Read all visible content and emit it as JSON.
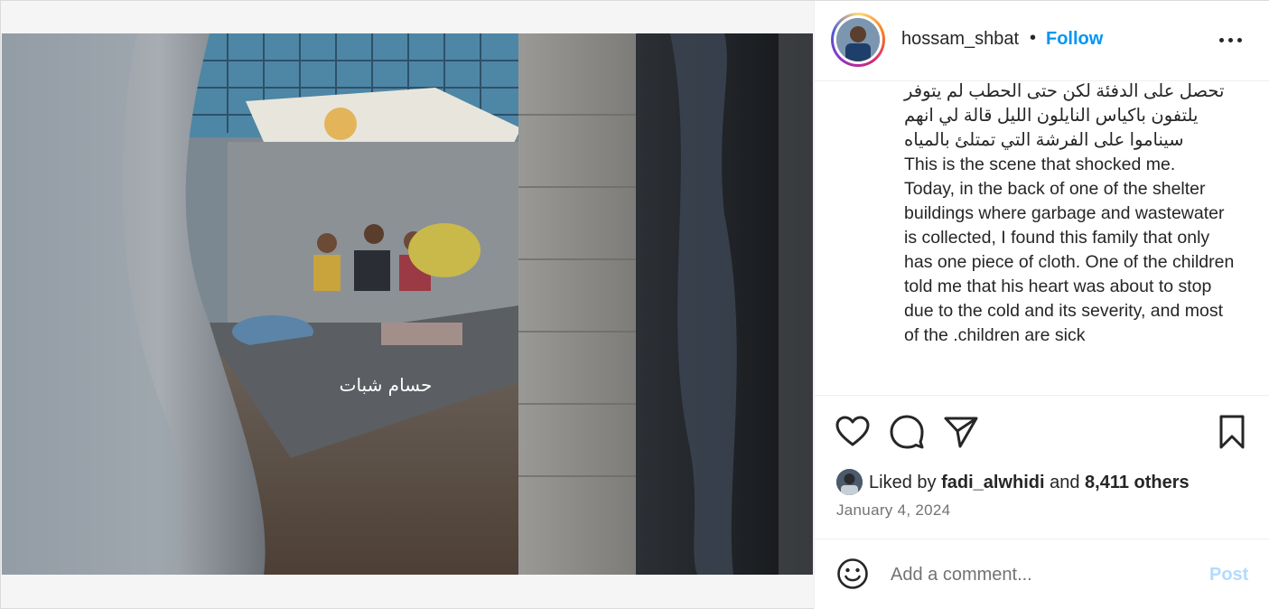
{
  "post": {
    "username": "hossam_shbat",
    "separator": "•",
    "follow_label": "Follow",
    "caption_arabic": "تحصل على الدفئة لكن حتى الحطب لم يتوفر يلتفون باكياس النايلون الليل قالة لي انهم سيناموا على الفرشة التي تمتلئ بالمياه",
    "caption_english": "This is the scene that shocked me.\nToday, in the back of one of the shelter buildings where garbage and wastewater is collected, I found this family that only has one piece of cloth. One of the children told me that his heart was about to stop due to the cold and its severity, and most of the .children are sick",
    "watermark": "حسام شبات",
    "liked_by_prefix": "Liked by",
    "liked_by_user": "fadi_alwhidi",
    "liked_by_and": "and",
    "liked_by_others": "8,411 others",
    "date": "January 4, 2024"
  },
  "comment": {
    "placeholder": "Add a comment...",
    "post_label": "Post"
  },
  "icons": {
    "like": "heart-icon",
    "comment": "comment-bubble-icon",
    "share": "paper-plane-icon",
    "save": "bookmark-icon",
    "emoji": "smiley-icon",
    "more": "more-dots-icon"
  },
  "colors": {
    "follow": "#0095f6",
    "post_disabled": "#b3dbff",
    "text": "#262626",
    "muted": "#737373"
  }
}
